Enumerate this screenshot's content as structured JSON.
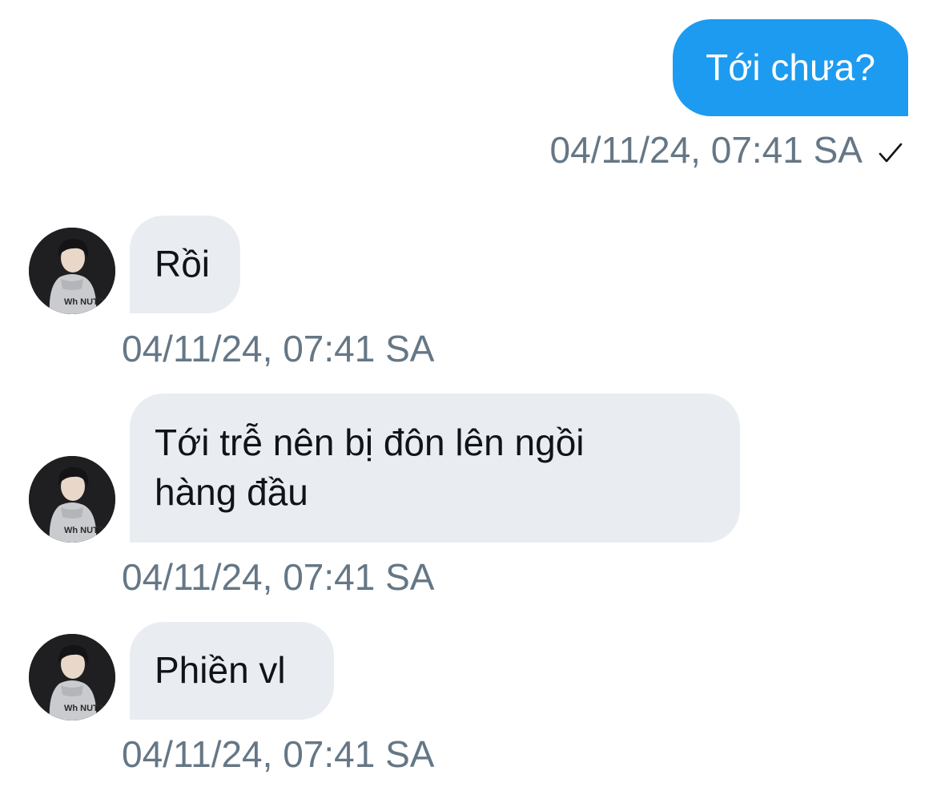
{
  "conversation": {
    "messages": [
      {
        "direction": "outgoing",
        "text": "Tới chưa?",
        "timestamp": "04/11/24, 07:41 SA",
        "read_icon": "checkmark-icon"
      },
      {
        "direction": "incoming",
        "text": "Rồi",
        "timestamp": "04/11/24, 07:41 SA"
      },
      {
        "direction": "incoming",
        "text_line1": "Tới trễ nên bị đôn lên ngồi",
        "text_line2": "hàng đầu",
        "timestamp": "04/11/24, 07:41 SA"
      },
      {
        "direction": "incoming",
        "text": "Phiền vl",
        "timestamp": "04/11/24, 07:41 SA"
      }
    ]
  },
  "colors": {
    "outgoing_bubble": "#1d9bf0",
    "incoming_bubble": "#e9edf1",
    "timestamp_text": "#657786",
    "message_text": "#0f1419"
  }
}
